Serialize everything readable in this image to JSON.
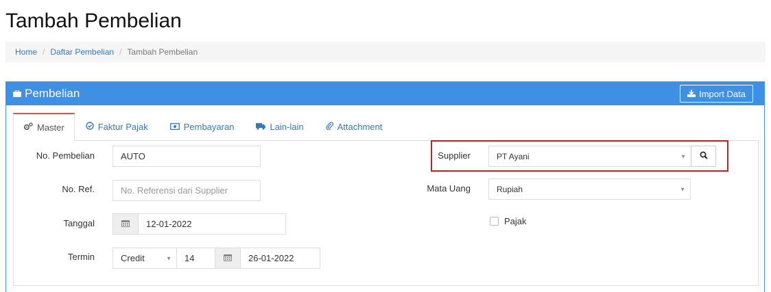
{
  "page": {
    "title": "Tambah Pembelian"
  },
  "breadcrumb": {
    "home": "Home",
    "list": "Daftar Pembelian",
    "current": "Tambah Pembelian"
  },
  "panel": {
    "title": "Pembelian",
    "import_label": "Import Data"
  },
  "tabs": [
    {
      "label": "Master",
      "icon": "cogs-icon"
    },
    {
      "label": "Faktur Pajak",
      "icon": "check-circle-icon"
    },
    {
      "label": "Pembayaran",
      "icon": "money-icon"
    },
    {
      "label": "Lain-lain",
      "icon": "truck-icon"
    },
    {
      "label": "Attachment",
      "icon": "paperclip-icon"
    }
  ],
  "form": {
    "no_pembelian": {
      "label": "No. Pembelian",
      "value": "AUTO"
    },
    "no_ref": {
      "label": "No. Ref.",
      "placeholder": "No. Referensi dari Supplier"
    },
    "tanggal": {
      "label": "Tanggal",
      "value": "12-01-2022"
    },
    "termin": {
      "label": "Termin",
      "type": "Credit",
      "days": "14",
      "due_date": "26-01-2022"
    },
    "supplier": {
      "label": "Supplier",
      "value": "PT Ayani"
    },
    "mata_uang": {
      "label": "Mata Uang",
      "value": "Rupiah"
    },
    "pajak": {
      "label": "Pajak",
      "checked": false
    }
  },
  "colors": {
    "panel_header": "#3f8fe3",
    "link": "#337ab7",
    "active_tab_top": "#d9534f",
    "highlight": "#cc1d1d"
  }
}
